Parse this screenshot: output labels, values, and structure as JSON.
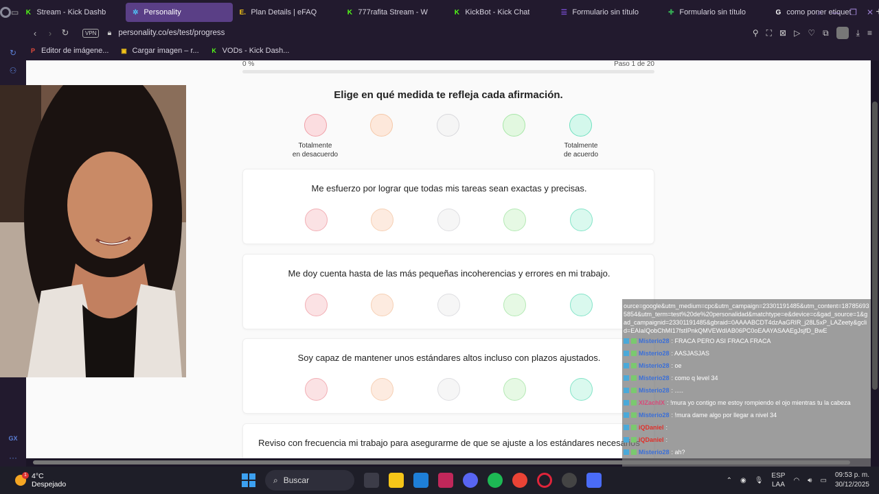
{
  "browser": {
    "tabs": [
      {
        "label": "Stream - Kick Dashb",
        "favicon": "K",
        "favicon_color": "#53fc18",
        "active": false
      },
      {
        "label": "Personality",
        "favicon": "✲",
        "favicon_color": "#4fc3f7",
        "active": true
      },
      {
        "label": "Plan Details | eFAQ",
        "favicon": "E.",
        "favicon_color": "#f5c518",
        "active": false
      },
      {
        "label": "777rafita Stream - W",
        "favicon": "K",
        "favicon_color": "#53fc18",
        "active": false
      },
      {
        "label": "KickBot - Kick Chat",
        "favicon": "K",
        "favicon_color": "#53fc18",
        "active": false
      },
      {
        "label": "Formulario sin título",
        "favicon": "☰",
        "favicon_color": "#7b4fd6",
        "active": false
      },
      {
        "label": "Formulario sin título",
        "favicon": "✚",
        "favicon_color": "#34a853",
        "active": false
      },
      {
        "label": "como poner etiquet",
        "favicon": "G",
        "favicon_color": "#ffffff",
        "active": false
      }
    ],
    "url": "personality.co/es/test/progress",
    "vpn_label": "VPN",
    "bookmarks": [
      {
        "label": "Editor de imágene...",
        "favicon": "P",
        "favicon_color": "#e74c3c"
      },
      {
        "label": "Cargar imagen – r...",
        "favicon": "▣",
        "favicon_color": "#f5c518"
      },
      {
        "label": "VODs - Kick Dash...",
        "favicon": "K",
        "favicon_color": "#53fc18"
      }
    ],
    "sidebar_bottom_label": "GX"
  },
  "test": {
    "progress_percent_label": "0 %",
    "progress_value": 0,
    "step_label": "Paso 1 de 20",
    "instruction": "Elige en qué medida te refleja cada afirmación.",
    "scale_left_label": "Totalmente\nen desacuerdo",
    "scale_right_label": "Totalmente\nde acuerdo",
    "scale_colors": [
      "#f0a0a8",
      "#f5c8a8",
      "#d8d8dc",
      "#a8e6a8",
      "#70e0c0"
    ],
    "scale_fills": [
      "#fbdde0",
      "#fde8db",
      "#f5f5f5",
      "#e2f8e0",
      "#d4f8ec"
    ],
    "statements": [
      "Me esfuerzo por lograr que todas mis tareas sean exactas y precisas.",
      "Me doy cuenta hasta de las más pequeñas incoherencias y errores en mi trabajo.",
      "Soy capaz de mantener unos estándares altos incluso con plazos ajustados.",
      "Reviso con frecuencia mi trabajo para asegurarme de que se ajuste a los estándares necesarios"
    ]
  },
  "chat": {
    "url_fragment": "ource=google&utm_medium=cpc&utm_campaign=23301191485&utm_content=187856935854&utm_term=test%20de%20personalidad&matchtype=e&device=c&gad_source=1&gad_campaignid=23301191485&gbraid=0AAAABCDT4dzAaGRIR_j28L5xP_LAZeety&gclid=EAIaIQobChMI17fstIPnkQMVEWdIAB06PC0oEAAYASAAEgJsjfD_BwE",
    "messages": [
      {
        "user": "Misterio28",
        "text": ": FRACA PERO ASI FRACA FRACA",
        "user_color": "#3a6fd8"
      },
      {
        "user": "Misterio28",
        "text": ": AASJASJAS",
        "user_color": "#3a6fd8"
      },
      {
        "user": "Misterio28",
        "text": ": oe",
        "user_color": "#3a6fd8"
      },
      {
        "user": "Misterio28",
        "text": ": como q level 34",
        "user_color": "#3a6fd8"
      },
      {
        "user": "Misterio28",
        "text": ": .....",
        "user_color": "#3a6fd8"
      },
      {
        "user": "XIZachIX",
        "text": ": !mura yo contigo me estoy rompiendo el ojo mientras tu la cabeza",
        "user_color": "#d84a7a"
      },
      {
        "user": "Misterio28",
        "text": ": !mura dame algo por llegar a nivel 34",
        "user_color": "#3a6fd8"
      },
      {
        "user": "iQDaniel",
        "text": ":",
        "user_color": "#e0302a"
      },
      {
        "user": "iQDaniel",
        "text": ":",
        "user_color": "#e0302a"
      },
      {
        "user": "Misterio28",
        "text": ": ah?",
        "user_color": "#3a6fd8"
      }
    ]
  },
  "taskbar": {
    "temperature": "4°C",
    "weather": "Despejado",
    "weather_badge": "1",
    "search_label": "Buscar",
    "lang_top": "ESP",
    "lang_bottom": "LAA",
    "time": "09:53 p. m.",
    "date": "30/12/2025"
  }
}
